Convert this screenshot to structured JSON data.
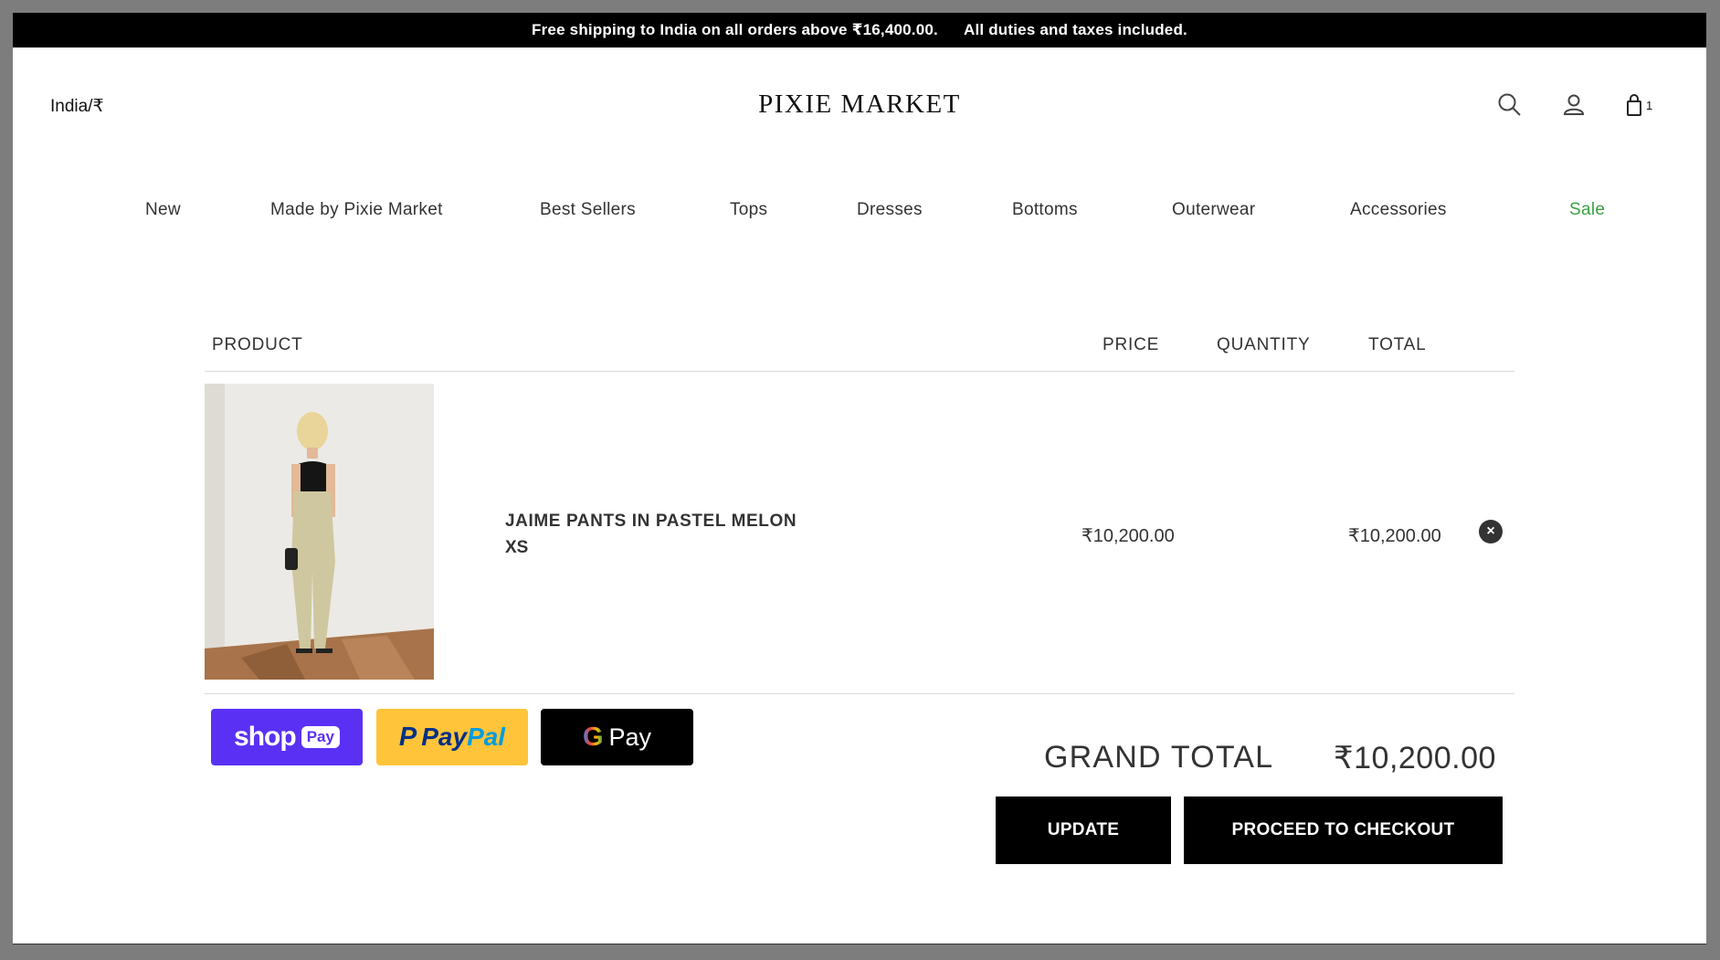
{
  "announcement": {
    "shipping": "Free shipping to India on all orders above ₹16,400.00.",
    "duties": "All duties and taxes included."
  },
  "header": {
    "locale": "India/₹",
    "logo": "PIXIE MARKET",
    "cart_count": "1",
    "icons": [
      "search-icon",
      "account-icon",
      "cart-icon"
    ]
  },
  "nav": {
    "items": [
      "New",
      "Made by Pixie Market",
      "Best Sellers",
      "Tops",
      "Dresses",
      "Bottoms",
      "Outerwear",
      "Accessories",
      "Sale"
    ],
    "sale_color": "#3aa142"
  },
  "cart": {
    "columns": {
      "product": "PRODUCT",
      "price": "PRICE",
      "quantity": "QUANTITY",
      "total": "TOTAL"
    },
    "items": [
      {
        "name": "JAIME PANTS IN PASTEL MELON",
        "variant": "XS",
        "price": "₹10,200.00",
        "total": "₹10,200.00"
      }
    ],
    "remove_icon": "×"
  },
  "payment": {
    "shop_word": "shop",
    "shop_pay": "Pay",
    "paypal_p": "P",
    "paypal_pay": "Pay",
    "paypal_pal": "Pal",
    "gpay_g": "G",
    "gpay_pay": "Pay",
    "colors": {
      "shop": "#5a31f4",
      "paypal": "#ffc439",
      "gpay": "#000000"
    }
  },
  "summary": {
    "grand_total_label": "GRAND TOTAL",
    "grand_total_value": "₹10,200.00",
    "update_label": "UPDATE",
    "checkout_label": "PROCEED TO CHECKOUT"
  }
}
